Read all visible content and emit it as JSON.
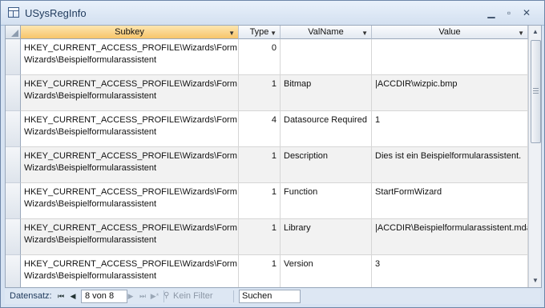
{
  "window": {
    "title": "USysRegInfo",
    "icon": "table-icon",
    "controls": [
      "minimize-icon",
      "restore-icon",
      "close-icon"
    ]
  },
  "table": {
    "columns": [
      {
        "label": "Subkey",
        "active": true
      },
      {
        "label": "Type",
        "active": false
      },
      {
        "label": "ValName",
        "active": false
      },
      {
        "label": "Value",
        "active": false
      }
    ],
    "rows": [
      {
        "subkey": "HKEY_CURRENT_ACCESS_PROFILE\\Wizards\\Form\nWizards\\Beispielformularassistent",
        "type": "0",
        "valname": "",
        "value": ""
      },
      {
        "subkey": "HKEY_CURRENT_ACCESS_PROFILE\\Wizards\\Form\nWizards\\Beispielformularassistent",
        "type": "1",
        "valname": "Bitmap",
        "value": "|ACCDIR\\wizpic.bmp"
      },
      {
        "subkey": "HKEY_CURRENT_ACCESS_PROFILE\\Wizards\\Form\nWizards\\Beispielformularassistent",
        "type": "4",
        "valname": "Datasource Required",
        "value": "1"
      },
      {
        "subkey": "HKEY_CURRENT_ACCESS_PROFILE\\Wizards\\Form\nWizards\\Beispielformularassistent",
        "type": "1",
        "valname": "Description",
        "value": "Dies ist ein Beispielformularassistent."
      },
      {
        "subkey": "HKEY_CURRENT_ACCESS_PROFILE\\Wizards\\Form\nWizards\\Beispielformularassistent",
        "type": "1",
        "valname": "Function",
        "value": "StartFormWizard"
      },
      {
        "subkey": "HKEY_CURRENT_ACCESS_PROFILE\\Wizards\\Form\nWizards\\Beispielformularassistent",
        "type": "1",
        "valname": "Library",
        "value": "|ACCDIR\\Beispielformularassistent.mda"
      },
      {
        "subkey": "HKEY_CURRENT_ACCESS_PROFILE\\Wizards\\Form\nWizards\\Beispielformularassistent",
        "type": "1",
        "valname": "Version",
        "value": "3"
      }
    ]
  },
  "navigation": {
    "label": "Datensatz:",
    "record": "8 von 8",
    "filter_label": "Kein Filter",
    "search_label": "Suchen"
  },
  "colors": {
    "active_header": "#f7c56a",
    "alt_row": "#f2f2f2",
    "frame": "#d7e3f2"
  }
}
